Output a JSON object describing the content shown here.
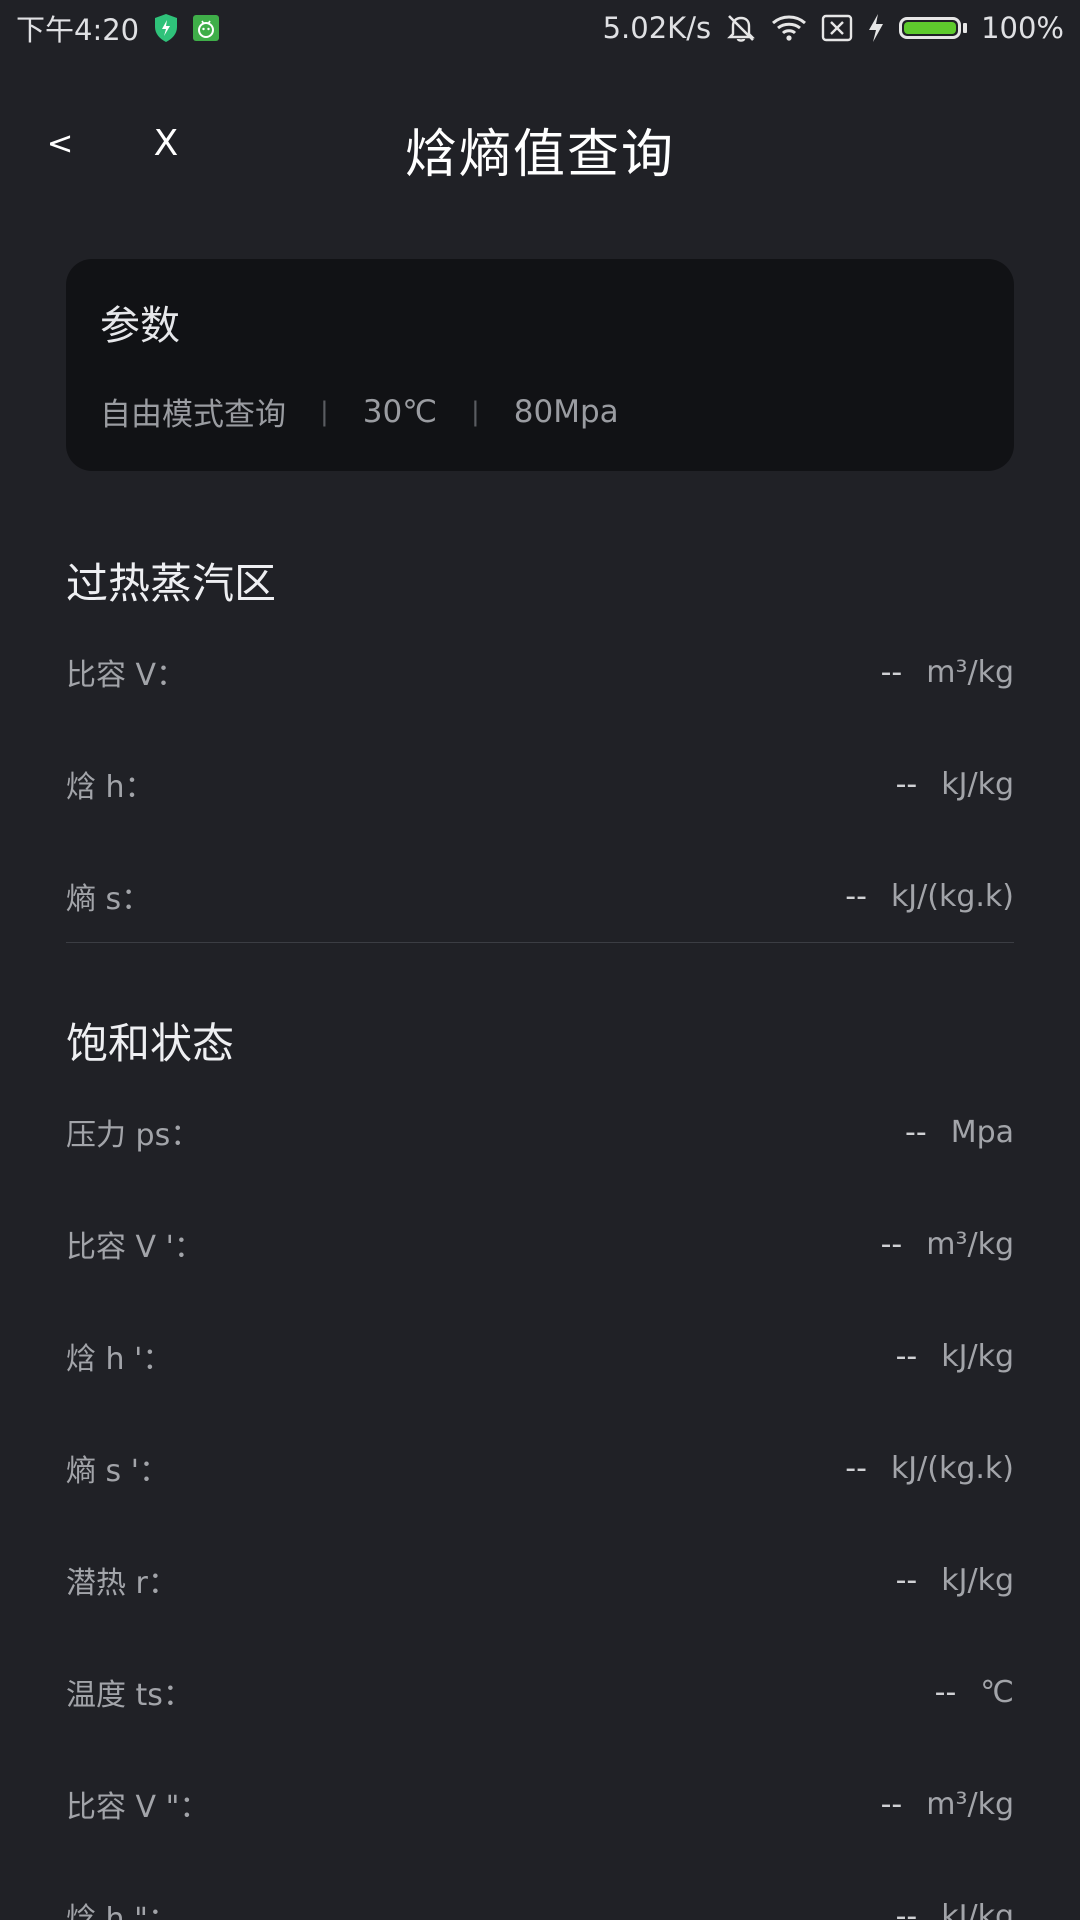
{
  "status_bar": {
    "time": "下午4:20",
    "network_speed": "5.02K/s",
    "battery_percent": "100%",
    "icons": [
      "shield-icon",
      "android-icon",
      "mute-icon",
      "wifi-icon",
      "no-sim-icon",
      "charging-icon",
      "battery-icon"
    ]
  },
  "header": {
    "back_label": "<",
    "close_label": "X",
    "title": "焓熵值查询"
  },
  "params": {
    "title": "参数",
    "mode": "自由模式查询",
    "sep": "|",
    "temperature": "30℃",
    "pressure": "80Mpa"
  },
  "superheated": {
    "title": "过热蒸汽区",
    "rows": [
      {
        "label": "比容 V：",
        "value": "--",
        "unit": "m³/kg"
      },
      {
        "label": "焓 h：",
        "value": "--",
        "unit": "kJ/kg"
      },
      {
        "label": "熵 s：",
        "value": "--",
        "unit": "kJ/(kg.k)"
      }
    ]
  },
  "saturation": {
    "title": "饱和状态",
    "rows": [
      {
        "label": "压力 ps：",
        "value": "--",
        "unit": "Mpa"
      },
      {
        "label": "比容 V '：",
        "value": "--",
        "unit": "m³/kg"
      },
      {
        "label": "焓 h '：",
        "value": "--",
        "unit": "kJ/kg"
      },
      {
        "label": "熵 s '：",
        "value": "--",
        "unit": "kJ/(kg.k)"
      },
      {
        "label": "潜热 r：",
        "value": "--",
        "unit": "kJ/kg"
      },
      {
        "label": "温度 ts：",
        "value": "--",
        "unit": "℃"
      },
      {
        "label": "比容 V \"：",
        "value": "--",
        "unit": "m³/kg"
      },
      {
        "label": "焓 h \"：",
        "value": "--",
        "unit": "kJ/kg"
      }
    ]
  }
}
